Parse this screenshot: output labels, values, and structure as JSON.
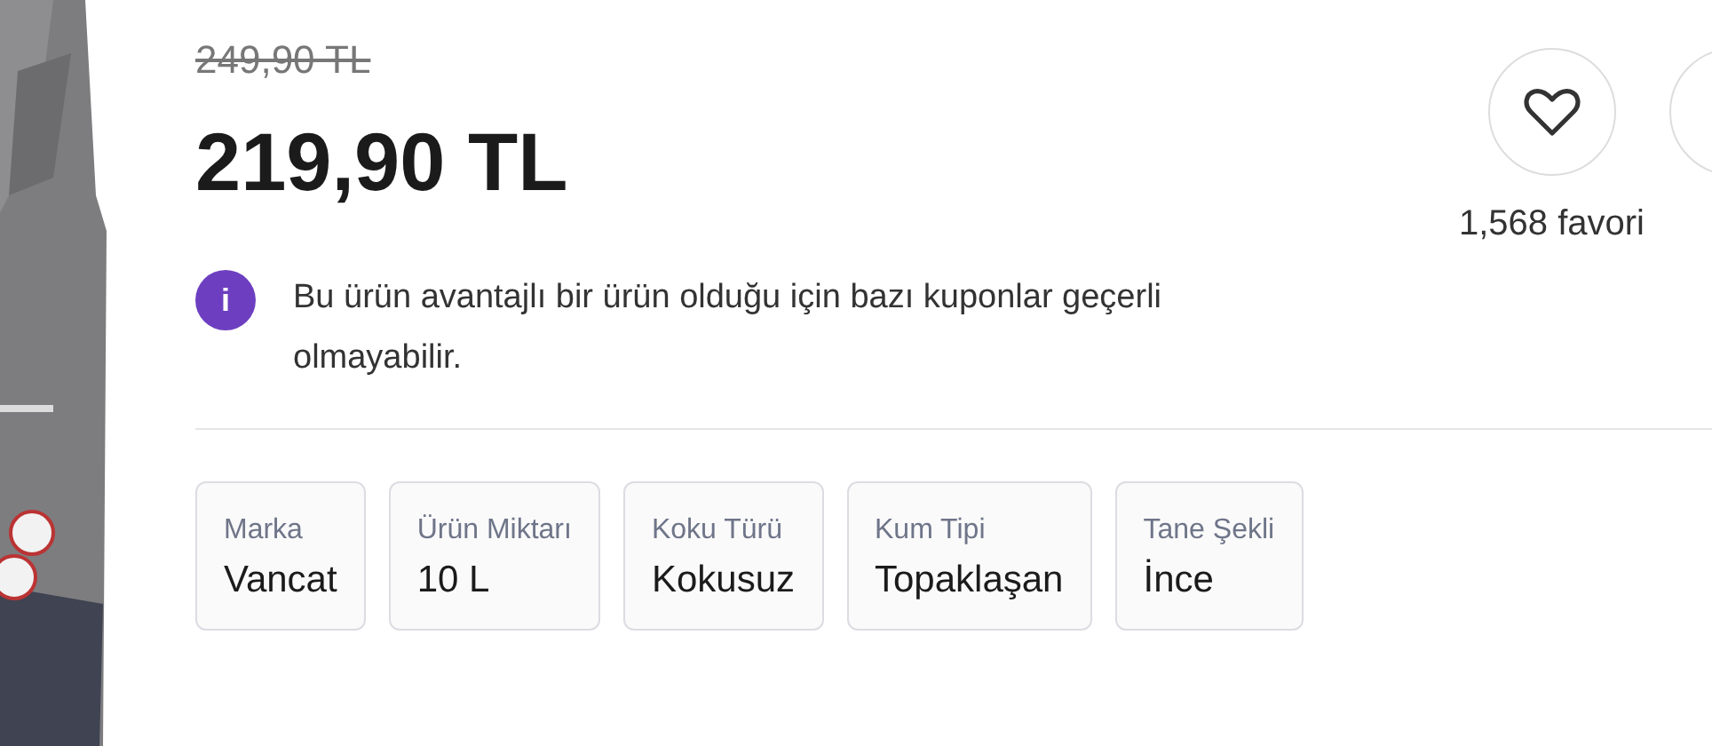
{
  "price": {
    "old": "249,90 TL",
    "current": "219,90 TL"
  },
  "favorite": {
    "count_text": "1,568 favori"
  },
  "notice": {
    "icon": "i",
    "text": "Bu ürün avantajlı bir ürün olduğu için bazı kuponlar geçerli olmayabilir."
  },
  "attributes": [
    {
      "label": "Marka",
      "value": "Vancat"
    },
    {
      "label": "Ürün Miktarı",
      "value": "10 L"
    },
    {
      "label": "Koku Türü",
      "value": "Kokusuz"
    },
    {
      "label": "Kum Tipi",
      "value": "Topaklaşan"
    },
    {
      "label": "Tane Şekli",
      "value": "İnce"
    }
  ]
}
